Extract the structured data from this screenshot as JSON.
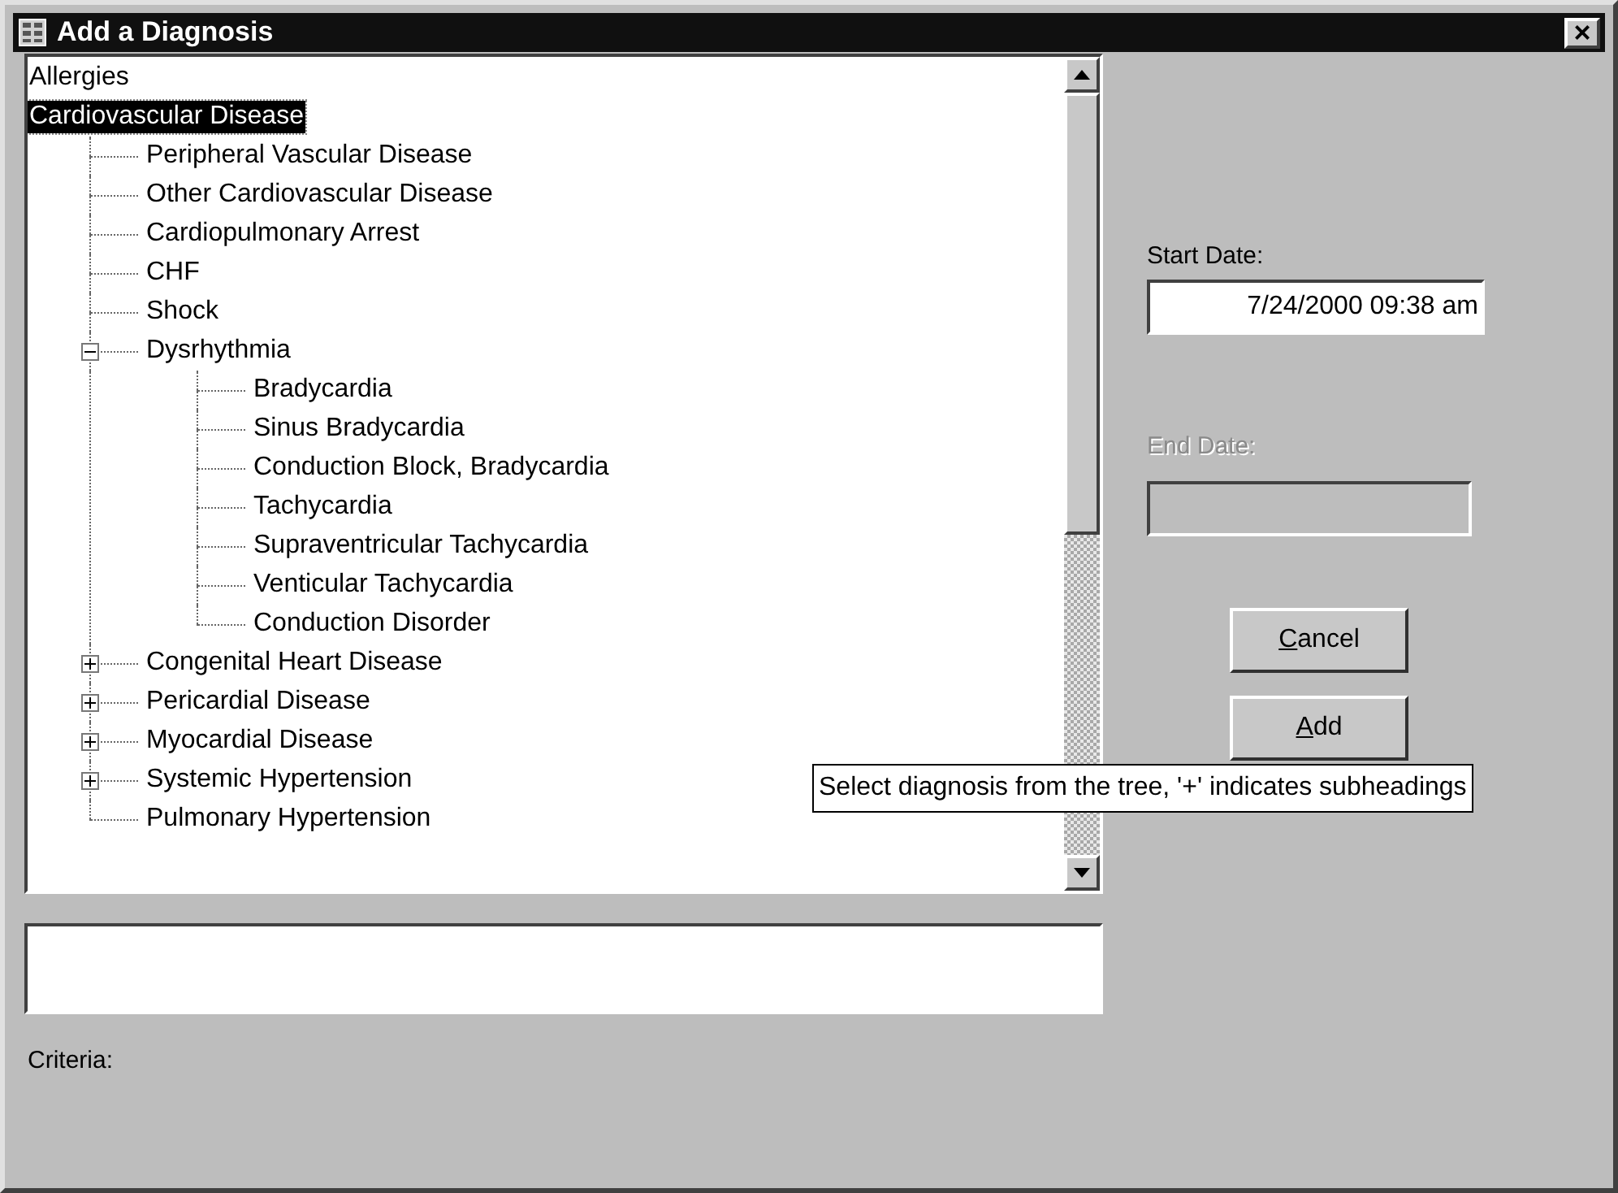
{
  "window": {
    "title": "Add a Diagnosis",
    "close": "×"
  },
  "tree": {
    "items": [
      {
        "label": "Allergies",
        "selected": false
      },
      {
        "label": "Cardiovascular Disease",
        "selected": true,
        "children": [
          {
            "label": "Peripheral Vascular Disease",
            "selected": false
          },
          {
            "label": "Other Cardiovascular Disease",
            "selected": false
          },
          {
            "label": "Cardiopulmonary Arrest",
            "selected": false
          },
          {
            "label": "CHF",
            "selected": false
          },
          {
            "label": "Shock",
            "selected": false
          },
          {
            "label": "Dysrhythmia",
            "selected": false,
            "expanded": true,
            "children": [
              {
                "label": "Bradycardia",
                "selected": false
              },
              {
                "label": "Sinus Bradycardia",
                "selected": false
              },
              {
                "label": "Conduction Block, Bradycardia",
                "selected": false
              },
              {
                "label": "Tachycardia",
                "selected": false
              },
              {
                "label": "Supraventricular Tachycardia",
                "selected": false
              },
              {
                "label": "Venticular Tachycardia",
                "selected": false
              },
              {
                "label": "Conduction Disorder",
                "selected": false
              }
            ]
          },
          {
            "label": "Congenital Heart Disease",
            "selected": false,
            "expanded": false
          },
          {
            "label": "Pericardial Disease",
            "selected": false,
            "expanded": false
          },
          {
            "label": "Myocardial Disease",
            "selected": false,
            "expanded": false
          },
          {
            "label": "Systemic Hypertension",
            "selected": false,
            "expanded": false
          },
          {
            "label": "Pulmonary Hypertension",
            "selected": false
          }
        ]
      }
    ]
  },
  "criteria_label": "Criteria:",
  "start_date": {
    "label": "Start Date:",
    "value": "7/24/2000 09:38 am",
    "disabled": false
  },
  "end_date": {
    "label": "End Date:",
    "disabled": true
  },
  "buttons": [
    {
      "label": "Cancel"
    },
    {
      "label": "Add"
    }
  ],
  "tooltip": "Select diagnosis from the tree, '+' indicates subheadings"
}
